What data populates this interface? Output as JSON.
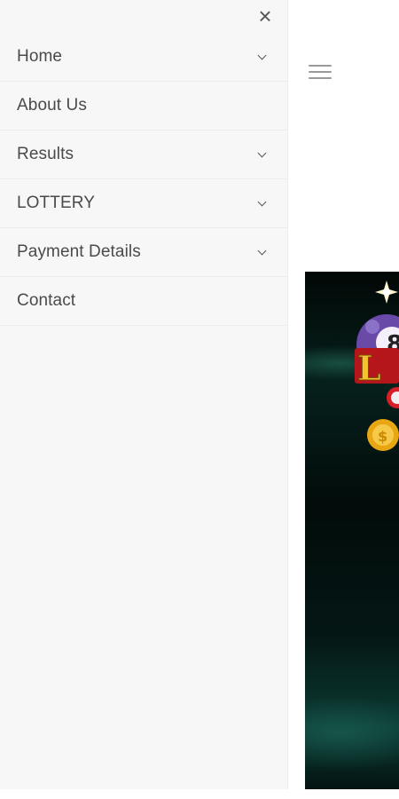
{
  "drawer": {
    "close_symbol": "×",
    "items": [
      {
        "label": "Home",
        "has_submenu": true
      },
      {
        "label": "About Us",
        "has_submenu": false
      },
      {
        "label": "Results",
        "has_submenu": true
      },
      {
        "label": "LOTTERY",
        "has_submenu": true
      },
      {
        "label": "Payment Details",
        "has_submenu": true
      },
      {
        "label": "Contact",
        "has_submenu": false
      }
    ]
  },
  "header": {
    "menu_icon": "hamburger-menu-icon"
  },
  "hero": {
    "image": "lottery-banner-image"
  },
  "colors": {
    "drawer_bg": "#f7f7f7",
    "text": "#4a4a4a",
    "divider": "#ececec",
    "hero_dark": "#020806",
    "hero_teal": "#0c3a33"
  }
}
